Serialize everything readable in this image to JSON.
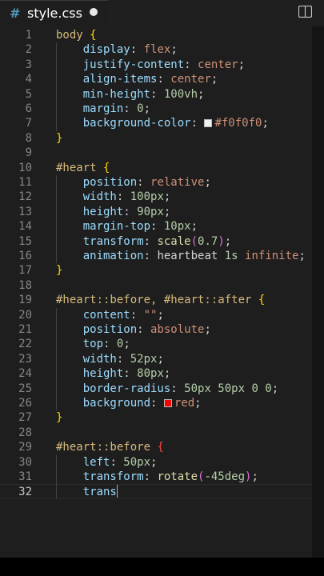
{
  "tab": {
    "icon": "#",
    "icon_name": "css-hash-icon",
    "title": "style.css",
    "modified": true
  },
  "toolbar": {
    "split_icon": "split-editor-icon"
  },
  "colors": {
    "accent": "#519aba",
    "background": "#1e1e1e",
    "swatch_f0": "#f0f0f0",
    "swatch_red": "#ff0000"
  },
  "editor": {
    "current_line": 32,
    "lines": [
      {
        "n": "1",
        "tokens": [
          [
            "sel",
            "body"
          ],
          [
            "punc",
            " "
          ],
          [
            "br1",
            "{"
          ]
        ]
      },
      {
        "n": "2",
        "tokens": [
          [
            "punc",
            "    "
          ],
          [
            "prop",
            "display"
          ],
          [
            "punc",
            ": "
          ],
          [
            "val",
            "flex"
          ],
          [
            "punc",
            ";"
          ]
        ]
      },
      {
        "n": "3",
        "tokens": [
          [
            "punc",
            "    "
          ],
          [
            "prop",
            "justify-content"
          ],
          [
            "punc",
            ": "
          ],
          [
            "val",
            "center"
          ],
          [
            "punc",
            ";"
          ]
        ]
      },
      {
        "n": "4",
        "tokens": [
          [
            "punc",
            "    "
          ],
          [
            "prop",
            "align-items"
          ],
          [
            "punc",
            ": "
          ],
          [
            "val",
            "center"
          ],
          [
            "punc",
            ";"
          ]
        ]
      },
      {
        "n": "5",
        "tokens": [
          [
            "punc",
            "    "
          ],
          [
            "prop",
            "min-height"
          ],
          [
            "punc",
            ": "
          ],
          [
            "num",
            "100vh"
          ],
          [
            "punc",
            ";"
          ]
        ]
      },
      {
        "n": "6",
        "tokens": [
          [
            "punc",
            "    "
          ],
          [
            "prop",
            "margin"
          ],
          [
            "punc",
            ": "
          ],
          [
            "num",
            "0"
          ],
          [
            "punc",
            ";"
          ]
        ]
      },
      {
        "n": "7",
        "tokens": [
          [
            "punc",
            "    "
          ],
          [
            "prop",
            "background-color"
          ],
          [
            "punc",
            ": "
          ],
          [
            "swatch",
            "#f0f0f0"
          ],
          [
            "val",
            "#f0f0f0"
          ],
          [
            "punc",
            ";"
          ]
        ]
      },
      {
        "n": "8",
        "tokens": [
          [
            "br1",
            "}"
          ]
        ]
      },
      {
        "n": "9",
        "tokens": []
      },
      {
        "n": "10",
        "tokens": [
          [
            "sel",
            "#heart"
          ],
          [
            "punc",
            " "
          ],
          [
            "br1",
            "{"
          ]
        ]
      },
      {
        "n": "11",
        "tokens": [
          [
            "punc",
            "    "
          ],
          [
            "prop",
            "position"
          ],
          [
            "punc",
            ": "
          ],
          [
            "val",
            "relative"
          ],
          [
            "punc",
            ";"
          ]
        ]
      },
      {
        "n": "12",
        "tokens": [
          [
            "punc",
            "    "
          ],
          [
            "prop",
            "width"
          ],
          [
            "punc",
            ": "
          ],
          [
            "num",
            "100px"
          ],
          [
            "punc",
            ";"
          ]
        ]
      },
      {
        "n": "13",
        "tokens": [
          [
            "punc",
            "    "
          ],
          [
            "prop",
            "height"
          ],
          [
            "punc",
            ": "
          ],
          [
            "num",
            "90px"
          ],
          [
            "punc",
            ";"
          ]
        ]
      },
      {
        "n": "14",
        "tokens": [
          [
            "punc",
            "    "
          ],
          [
            "prop",
            "margin-top"
          ],
          [
            "punc",
            ": "
          ],
          [
            "num",
            "10px"
          ],
          [
            "punc",
            ";"
          ]
        ]
      },
      {
        "n": "15",
        "tokens": [
          [
            "punc",
            "    "
          ],
          [
            "prop",
            "transform"
          ],
          [
            "punc",
            ": "
          ],
          [
            "fn",
            "scale"
          ],
          [
            "br2",
            "("
          ],
          [
            "num",
            "0.7"
          ],
          [
            "br2",
            ")"
          ],
          [
            "punc",
            ";"
          ]
        ]
      },
      {
        "n": "16",
        "tokens": [
          [
            "punc",
            "    "
          ],
          [
            "prop",
            "animation"
          ],
          [
            "punc",
            ": "
          ],
          [
            "punc",
            "heartbeat "
          ],
          [
            "num",
            "1s"
          ],
          [
            "punc",
            " "
          ],
          [
            "val",
            "infinite"
          ],
          [
            "punc",
            ";"
          ]
        ]
      },
      {
        "n": "17",
        "tokens": [
          [
            "br1",
            "}"
          ]
        ]
      },
      {
        "n": "18",
        "tokens": []
      },
      {
        "n": "19",
        "tokens": [
          [
            "sel",
            "#heart::before, #heart::after"
          ],
          [
            "punc",
            " "
          ],
          [
            "br1",
            "{"
          ]
        ]
      },
      {
        "n": "20",
        "tokens": [
          [
            "punc",
            "    "
          ],
          [
            "prop",
            "content"
          ],
          [
            "punc",
            ": "
          ],
          [
            "val",
            "\"\""
          ],
          [
            "punc",
            ";"
          ]
        ]
      },
      {
        "n": "21",
        "tokens": [
          [
            "punc",
            "    "
          ],
          [
            "prop",
            "position"
          ],
          [
            "punc",
            ": "
          ],
          [
            "val",
            "absolute"
          ],
          [
            "punc",
            ";"
          ]
        ]
      },
      {
        "n": "22",
        "tokens": [
          [
            "punc",
            "    "
          ],
          [
            "prop",
            "top"
          ],
          [
            "punc",
            ": "
          ],
          [
            "num",
            "0"
          ],
          [
            "punc",
            ";"
          ]
        ]
      },
      {
        "n": "23",
        "tokens": [
          [
            "punc",
            "    "
          ],
          [
            "prop",
            "width"
          ],
          [
            "punc",
            ": "
          ],
          [
            "num",
            "52px"
          ],
          [
            "punc",
            ";"
          ]
        ]
      },
      {
        "n": "24",
        "tokens": [
          [
            "punc",
            "    "
          ],
          [
            "prop",
            "height"
          ],
          [
            "punc",
            ": "
          ],
          [
            "num",
            "80px"
          ],
          [
            "punc",
            ";"
          ]
        ]
      },
      {
        "n": "25",
        "tokens": [
          [
            "punc",
            "    "
          ],
          [
            "prop",
            "border-radius"
          ],
          [
            "punc",
            ": "
          ],
          [
            "num",
            "50px 50px 0 0"
          ],
          [
            "punc",
            ";"
          ]
        ]
      },
      {
        "n": "26",
        "tokens": [
          [
            "punc",
            "    "
          ],
          [
            "prop",
            "background"
          ],
          [
            "punc",
            ": "
          ],
          [
            "swatch",
            "#ff0000"
          ],
          [
            "val",
            "red"
          ],
          [
            "punc",
            ";"
          ]
        ]
      },
      {
        "n": "27",
        "tokens": [
          [
            "br1",
            "}"
          ]
        ]
      },
      {
        "n": "28",
        "tokens": []
      },
      {
        "n": "29",
        "tokens": [
          [
            "sel",
            "#heart::before"
          ],
          [
            "punc",
            " "
          ],
          [
            "err",
            "{"
          ]
        ]
      },
      {
        "n": "30",
        "tokens": [
          [
            "punc",
            "    "
          ],
          [
            "prop",
            "left"
          ],
          [
            "punc",
            ": "
          ],
          [
            "num",
            "50px"
          ],
          [
            "punc",
            ";"
          ]
        ]
      },
      {
        "n": "31",
        "tokens": [
          [
            "punc",
            "    "
          ],
          [
            "prop",
            "transform"
          ],
          [
            "punc",
            ": "
          ],
          [
            "fn",
            "rotate"
          ],
          [
            "br2",
            "("
          ],
          [
            "num",
            "-45deg"
          ],
          [
            "br2",
            ")"
          ],
          [
            "punc",
            ";"
          ]
        ]
      },
      {
        "n": "32",
        "tokens": [
          [
            "punc",
            "    "
          ],
          [
            "prop",
            "trans"
          ],
          [
            "cursor",
            ""
          ]
        ]
      }
    ]
  }
}
